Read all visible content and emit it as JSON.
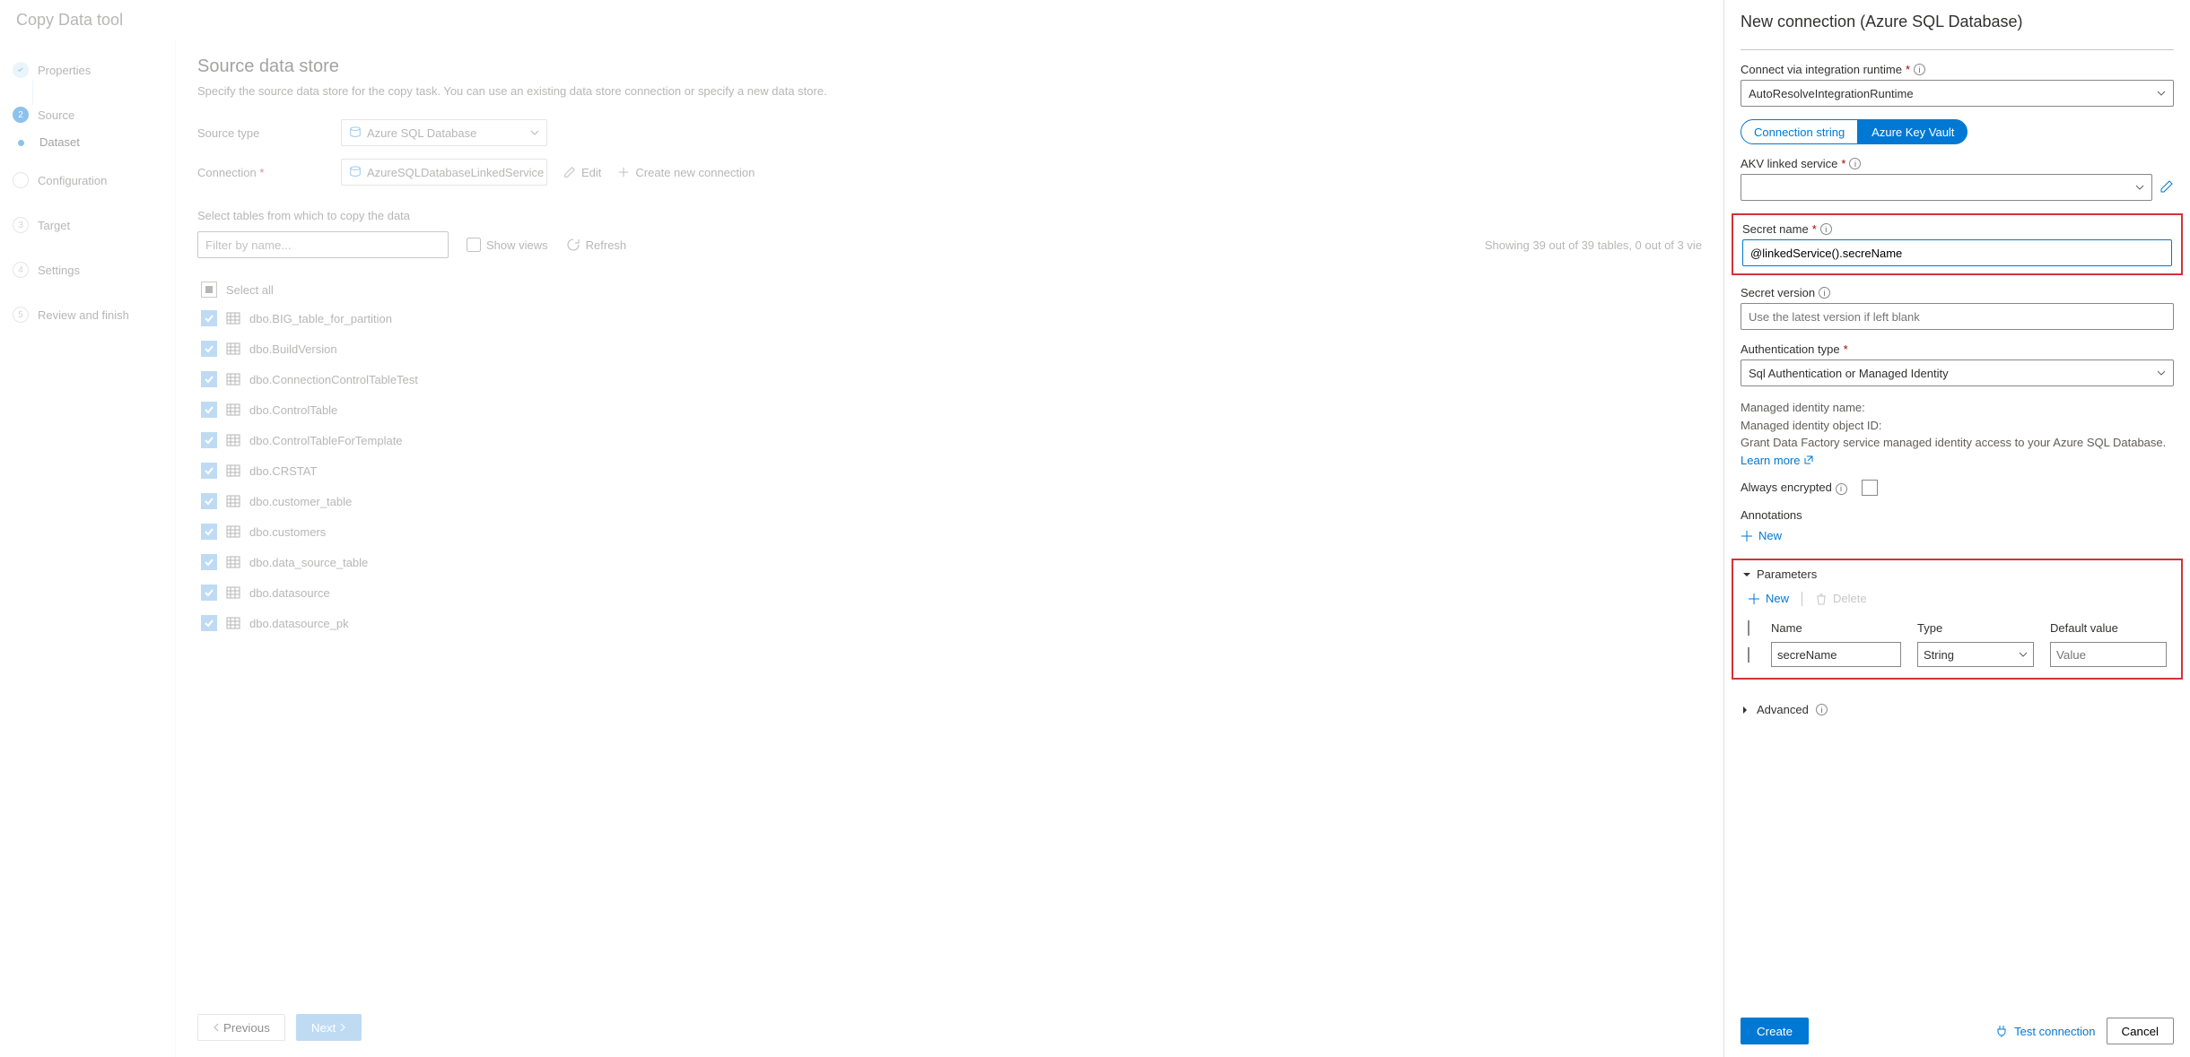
{
  "title": "Copy Data tool",
  "wizard": {
    "properties": "Properties",
    "source": "Source",
    "dataset": "Dataset",
    "configuration": "Configuration",
    "target": "Target",
    "settings": "Settings",
    "review": "Review and finish"
  },
  "content": {
    "heading": "Source data store",
    "desc": "Specify the source data store for the copy task. You can use an existing data store connection or specify a new data store.",
    "source_type_label": "Source type",
    "source_type_value": "Azure SQL Database",
    "connection_label": "Connection",
    "connection_value": "AzureSQLDatabaseLinkedService",
    "edit": "Edit",
    "create_new": "Create new connection",
    "select_tables_label": "Select tables from which to copy the data",
    "filter_placeholder": "Filter by name...",
    "show_views": "Show views",
    "refresh": "Refresh",
    "count_text": "Showing 39 out of 39 tables, 0 out of 3 vie",
    "select_all": "Select all",
    "tables": [
      "dbo.BIG_table_for_partition",
      "dbo.BuildVersion",
      "dbo.ConnectionControlTableTest",
      "dbo.ControlTable",
      "dbo.ControlTableForTemplate",
      "dbo.CRSTAT",
      "dbo.customer_table",
      "dbo.customers",
      "dbo.data_source_table",
      "dbo.datasource",
      "dbo.datasource_pk"
    ]
  },
  "footer": {
    "previous": "Previous",
    "next": "Next"
  },
  "panel": {
    "title": "New connection (Azure SQL Database)",
    "connect_via_label": "Connect via integration runtime",
    "connect_via_value": "AutoResolveIntegrationRuntime",
    "pill_conn": "Connection string",
    "pill_akv": "Azure Key Vault",
    "akv_label": "AKV linked service",
    "secret_name_label": "Secret name",
    "secret_name_value": "@linkedService().secreName",
    "secret_version_label": "Secret version",
    "secret_version_placeholder": "Use the latest version if left blank",
    "auth_type_label": "Authentication type",
    "auth_type_value": "Sql Authentication or Managed Identity",
    "mi_name": "Managed identity name:",
    "mi_obj": "Managed identity object ID:",
    "mi_grant": "Grant Data Factory service managed identity access to your Azure SQL Database.",
    "learn_more": "Learn more",
    "always_encrypted": "Always encrypted",
    "annotations": "Annotations",
    "new": "New",
    "parameters": "Parameters",
    "delete": "Delete",
    "col_name": "Name",
    "col_type": "Type",
    "col_default": "Default value",
    "param_name": "secreName",
    "param_type": "String",
    "param_default_placeholder": "Value",
    "advanced": "Advanced",
    "create": "Create",
    "test": "Test connection",
    "cancel": "Cancel"
  }
}
